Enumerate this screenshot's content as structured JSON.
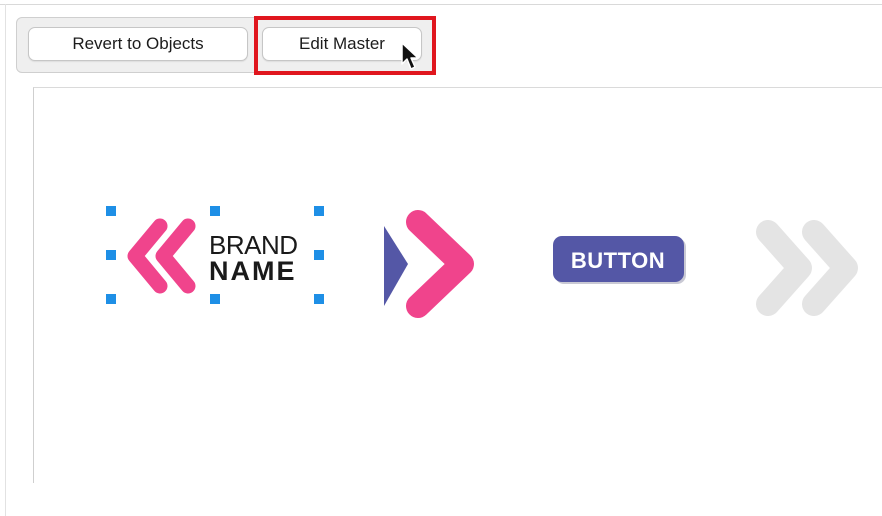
{
  "toolbar": {
    "revert_label": "Revert to Objects",
    "edit_master_label": "Edit Master"
  },
  "artboard": {
    "brand_line1": "BRAND",
    "brand_line2": "NAME",
    "button_text": "BUTTON"
  },
  "colors": {
    "pink": "#f0448c",
    "indigo": "#5457a6",
    "light_gray": "#e4e4e4",
    "selection_blue": "#1e8fe6",
    "highlight_red": "#e0161e"
  },
  "icons": {
    "cursor": "arrow-cursor-icon",
    "left_chevrons": "double-chevron-left-icon",
    "right_chevron": "chevron-right-icon",
    "gray_chevrons": "double-chevron-right-icon"
  }
}
